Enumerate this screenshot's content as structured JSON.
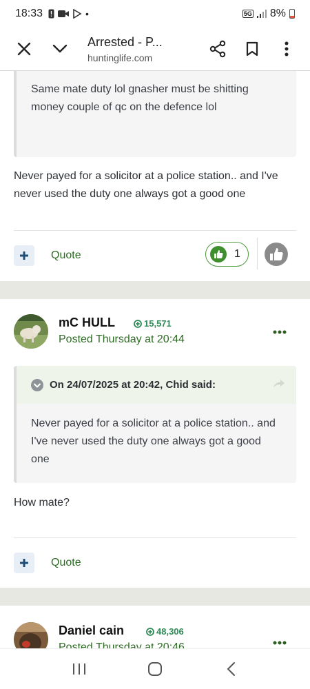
{
  "status_bar": {
    "time": "18:33",
    "network": "5G",
    "battery": "8%"
  },
  "browser": {
    "title": "Arrested - P...",
    "url": "huntinglife.com"
  },
  "post_prev": {
    "quote_text": "Same mate duty lol gnasher must be shitting money couple  of qc on the defence lol",
    "body": "Never payed for a solicitor at a police station.. and I've never used the duty one always got a good one",
    "quote_label": "Quote",
    "reaction_count": "1"
  },
  "post_mc_hull": {
    "author": "mC HULL",
    "reputation": "15,571",
    "posted": "Posted Thursday at 20:44",
    "quote_header": "On 24/07/2025 at 20:42, Chid said:",
    "quote_text": "Never payed for a solicitor at a police station.. and I've never used the duty one always got a good one",
    "body": "How mate?",
    "quote_label": "Quote"
  },
  "post_daniel": {
    "author": "Daniel cain",
    "reputation": "48,306",
    "posted": "Posted Thursday at 20:46"
  },
  "colors": {
    "accent_green": "#2e6b25",
    "rep_green": "#2e8b57",
    "quote_bg": "#f5f5f5",
    "band": "#e8e8e3"
  }
}
